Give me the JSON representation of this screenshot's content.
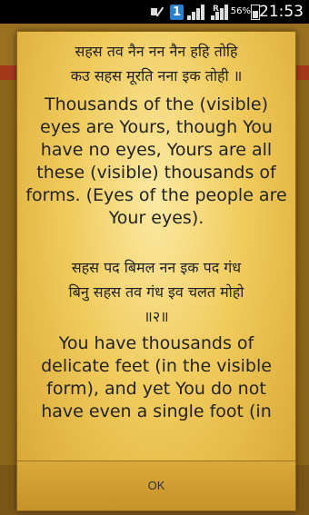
{
  "status_bar": {
    "battery_percent": "56%",
    "time": "21:53",
    "notification_badge": "1",
    "roaming_indicator": "R",
    "icons": [
      "muted-icon",
      "notification-1-icon",
      "signal-icon",
      "roaming-signal-icon",
      "battery-icon"
    ]
  },
  "dialog": {
    "verse1_line1": "सहस तव नैन नन नैन हहि तोहि",
    "verse1_line2": "कउ सहस मूरति नना इक तोही ॥",
    "translation1": "Thousands of the (visible) eyes are Yours, though You have no eyes, Yours are all these (visible) thousands of forms. (Eyes of the people are Your eyes).",
    "verse2_line1": "सहस पद बिमल नन इक पद गंध",
    "verse2_line2": "बिनु सहस तव गंध इव चलत मोहो",
    "verse2_line3": "॥२॥",
    "translation2": "You have thousands of delicate feet (in the visible form), and yet You do not have even a single foot (in",
    "ok_label": "OK"
  }
}
